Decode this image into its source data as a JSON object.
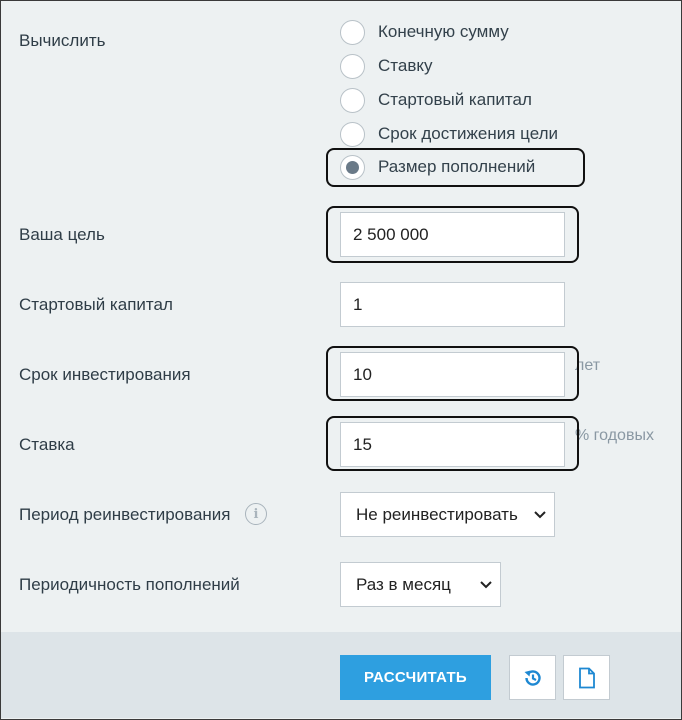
{
  "compute": {
    "label": "Вычислить",
    "options": [
      {
        "label": "Конечную сумму",
        "checked": false
      },
      {
        "label": "Ставку",
        "checked": false
      },
      {
        "label": "Стартовый капитал",
        "checked": false
      },
      {
        "label": "Срок достижения цели",
        "checked": false
      },
      {
        "label": "Размер пополнений",
        "checked": true
      }
    ]
  },
  "goal": {
    "label": "Ваша цель",
    "value": "2 500 000"
  },
  "start_capital": {
    "label": "Стартовый капитал",
    "value": "1"
  },
  "term": {
    "label": "Срок инвестирования",
    "value": "10",
    "suffix": "лет"
  },
  "rate": {
    "label": "Ставка",
    "value": "15",
    "suffix": "% годовых"
  },
  "reinvest": {
    "label": "Период реинвестирования",
    "value": "Не реинвестировать"
  },
  "topup": {
    "label": "Периодичность пополнений",
    "value": "Раз в месяц"
  },
  "actions": {
    "calculate_label": "РАССЧИТАТЬ"
  },
  "colors": {
    "accent": "#2e9fe0",
    "background": "#edf1f2",
    "footer": "#dde4e8"
  }
}
